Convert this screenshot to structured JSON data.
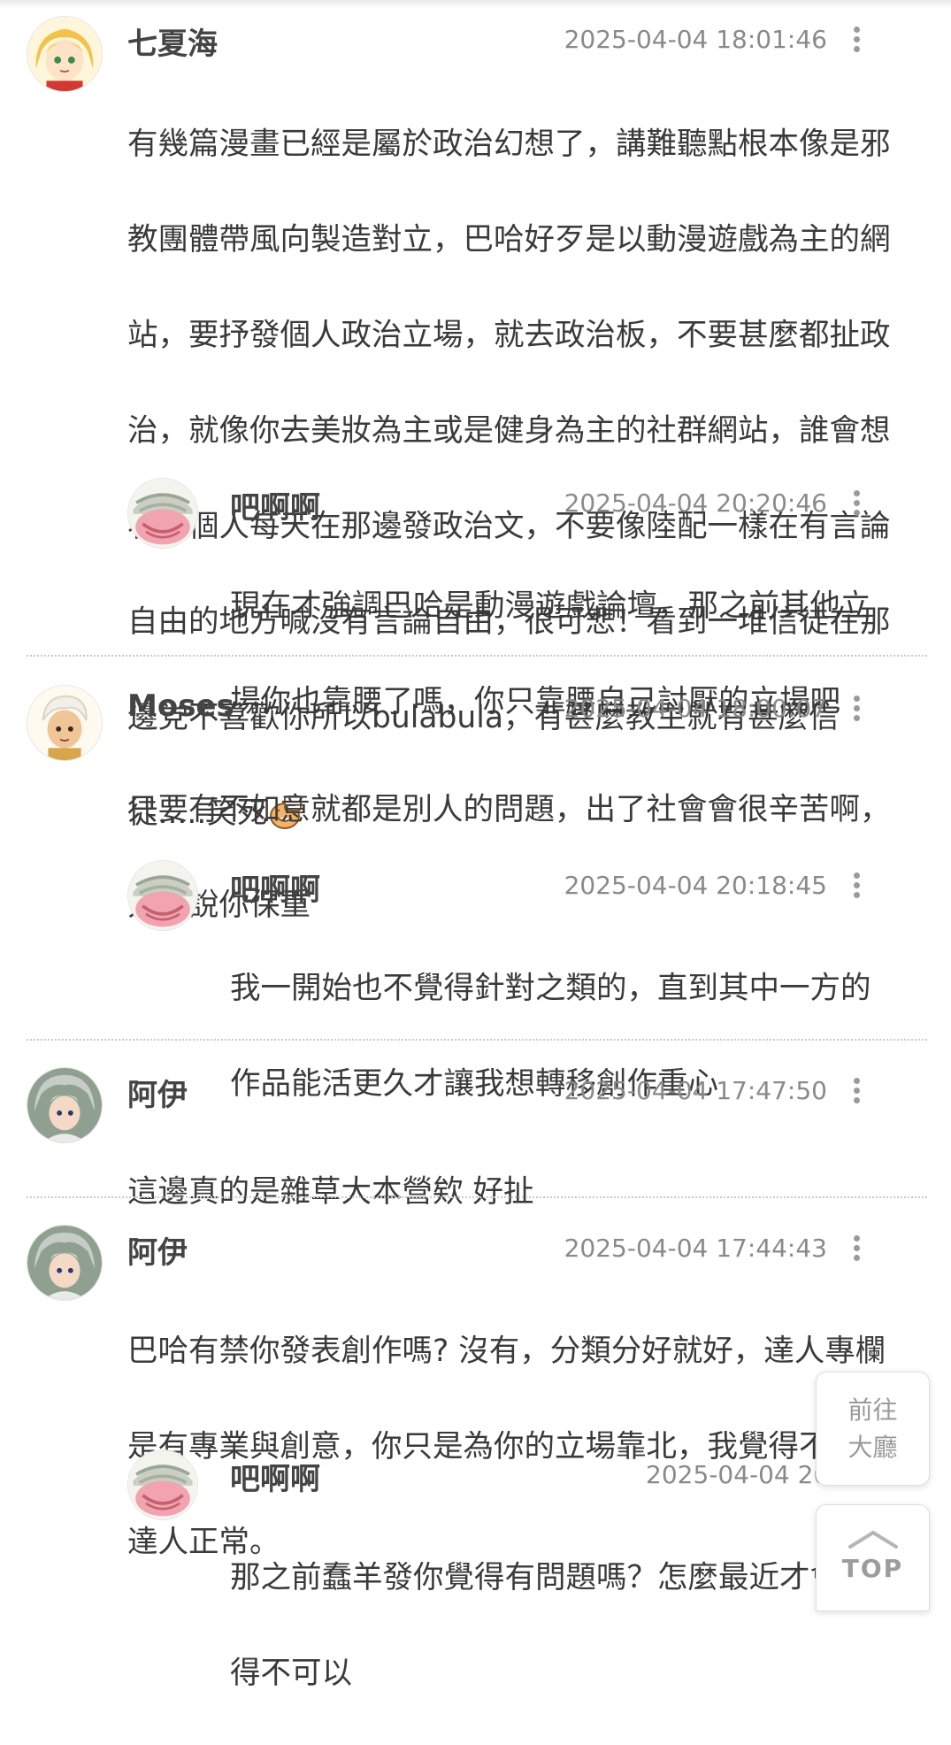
{
  "comments": [
    {
      "name": "七夏海",
      "time": "2025-04-04 18:01:46",
      "lines": [
        "有幾篇漫畫已經是屬於政治幻想了，講難聽點根本像是邪",
        "教團體帶風向製造對立，巴哈好歹是以動漫遊戲為主的網",
        "站，要抒發個人政治立場，就去政治板，不要甚麼都扯政",
        "治，就像你去美妝為主或是健身為主的社群網站，誰會想",
        "看一個人每天在那邊發政治文，不要像陸配一樣在有言論",
        "自由的地方喊沒有言論自由，很可悲！看到一堆信徒在那",
        "邊党不喜歡你所以bulabula，有甚麼教主就有甚麼信",
        "徒.....笑死"
      ],
      "reply": {
        "name": "吧啊啊",
        "time": "2025-04-04 20:20:46",
        "lines": [
          "現在才強調巴哈是動漫遊戲論壇，那之前其他立",
          "場你也靠腰了嗎，你只靠腰自己討厭的立場吧"
        ]
      }
    },
    {
      "name": "Moses",
      "time": "2025-04-04 18:00:07",
      "lines": [
        "只要有不如意就都是別人的問題，出了社會會很辛苦啊，",
        "只能說你保重"
      ],
      "reply": {
        "name": "吧啊啊",
        "time": "2025-04-04 20:18:45",
        "lines": [
          "我一開始也不覺得針對之類的，直到其中一方的",
          "作品能活更久才讓我想轉移創作重心"
        ]
      }
    },
    {
      "name": "阿伊",
      "time": "2025-04-04 17:47:50",
      "lines": [
        "這邊真的是雜草大本營欸 好扯"
      ]
    },
    {
      "name": "阿伊",
      "time": "2025-04-04 17:44:43",
      "lines": [
        "巴哈有禁你發表創作嗎? 沒有，分類分好就好，達人專欄",
        "是有專業與創意，你只是為你的立場靠北，我覺得不能發",
        "達人正常。"
      ],
      "reply": {
        "name": "吧啊啊",
        "time": "2025-04-04 20:",
        "lines": [
          "那之前蠢羊發你覺得有問題嗎？怎麼最近才會覺",
          "得不可以"
        ]
      }
    }
  ],
  "float_buttons": {
    "lobby_line1": "前往",
    "lobby_line2": "大廳",
    "top_label": "TOP"
  },
  "colors": {
    "name": "#444444",
    "time": "#8a8a8a",
    "text": "#3a3a3a",
    "divider": "#c9c9c9"
  }
}
